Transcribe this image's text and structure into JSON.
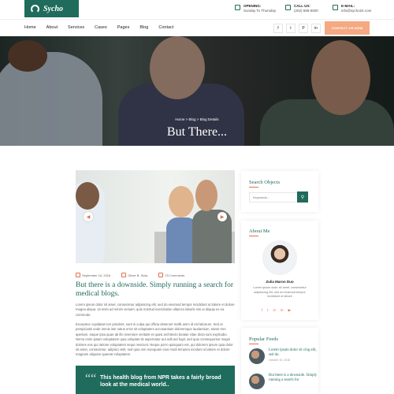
{
  "brand": {
    "name": "Sycho"
  },
  "topinfo": [
    {
      "label": "OPENING:",
      "value": "Sunday To Thursday"
    },
    {
      "label": "CALL US:",
      "value": "(202) 586-6500"
    },
    {
      "label": "E-MAIL:",
      "value": "info@sycho24.com"
    }
  ],
  "nav": {
    "items": [
      "Home",
      "About",
      "Services",
      "Cases",
      "Pages",
      "Blog",
      "Contact"
    ],
    "social": [
      "f",
      "t",
      "P",
      "in"
    ],
    "cta": "CONTACT US NOW"
  },
  "hero": {
    "breadcrumb": [
      "Home",
      "Blog",
      "Blog Details"
    ],
    "title": "But There..."
  },
  "post": {
    "meta": {
      "date": "September 16, 2018",
      "author": "Oliver B. Sixty",
      "comments": "23 Comments"
    },
    "title": "But there is a downside. Simply running a search for medical blogs.",
    "para1": "Lorem ipsum dolor sit amet, consectetur adipisicing elit, sed do eiusmod tempor incididunt ut labore et dolore magna aliqua. Ut enim ad minim veniam, quis nostrud exercitation ullamco laboris nisi ut aliquip ex ea commodo.",
    "para2": "Excepteur cupidatat non proident, sunt in culpa qui officia deserunt mollit anim id est laborum. Sed ut perspiciatis unde omnis iste natus error sit voluptatem accusantium doloremque laudantium, totam rem aperiam, eaque ipsa quae ab illo inventore veritatis et quasi architecto beatae vitae dicta sunt explicabo. Nemo enim ipsam voluptatem quia voluptas sit aspernatur aut odit aut fugit, sed quia consequuntur magni dolores eos qui ratione voluptatem sequi nesciunt. Neque porro quisquam est, qui dolorem ipsum quia dolor sit amet, consectetur, adipisci velit, sed quia non numquam eius modi tempora incidunt ut labore et dolore magnam aliquam quaerat voluptatem.",
    "quote": "This health blog from NPR takes a fairly broad look at the medical world.."
  },
  "sidebar": {
    "search": {
      "title": "Search Objects",
      "placeholder": "Keywords..."
    },
    "about": {
      "title": "About Me",
      "name": "Zulia Maron Duo",
      "text": "Lorem ipsum dolor sit amet, consectetur adipisicing elit, sed do eiusmod tempor incididunt ut labore",
      "social": [
        "f",
        "t",
        "in",
        "in",
        "▶"
      ]
    },
    "feeds": {
      "title": "Popular Feeds",
      "items": [
        {
          "title": "Lorem ipsum dolor sit cing elit, sed do.",
          "date": "October 15, 2018"
        },
        {
          "title": "But there is a downside. Simply running a search for",
          "date": ""
        }
      ]
    }
  },
  "colors": {
    "primary": "#1f6b5c",
    "accent": "#e27052",
    "cta": "#f4a982"
  }
}
